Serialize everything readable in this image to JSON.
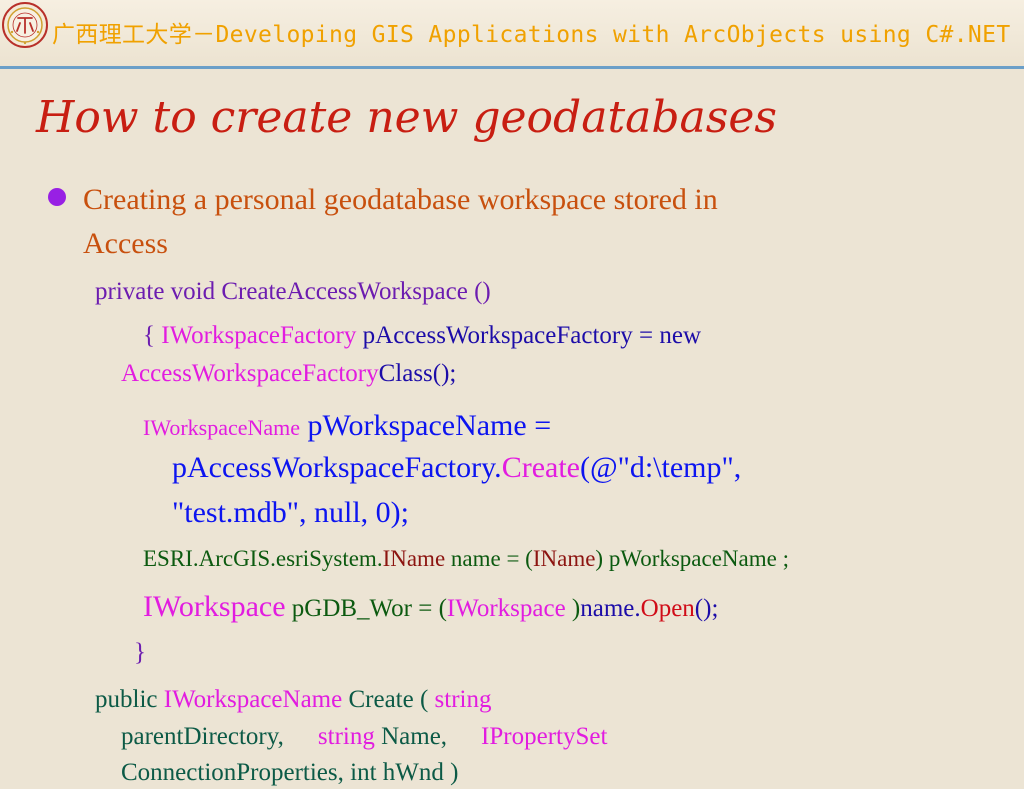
{
  "header": {
    "title_cn": "广西理工大学",
    "title_dash": "－",
    "title_en": "Developing GIS Applications with ArcObjects using C#.NET"
  },
  "slide": {
    "title": "How to create new geodatabases",
    "bullet_line1": "Creating a personal geodatabase workspace stored in",
    "bullet_line2": "Access"
  },
  "code": {
    "l1": "private void CreateAccessWorkspace ()",
    "l2_brace": "{ ",
    "l2_type": "IWorkspaceFactory",
    "l2_rest": " pAccessWorkspaceFactory = new",
    "l3_type": "AccessWorkspaceFactory",
    "l3_rest": "Class();",
    "l4_type": "IWorkspaceName",
    "l4_rest": " pWorkspaceName =",
    "l5_obj": "pAccessWorkspaceFactory.",
    "l5_method": "Create",
    "l5_rest": "(@\"d:\\temp\",",
    "l6": "\"test.mdb\", null, 0);",
    "l7_ns": "ESRI.ArcGIS.esriSystem.",
    "l7_type": "IName",
    "l7_mid": " name = (",
    "l7_cast": "IName",
    "l7_rest": ") pWorkspaceName ;",
    "l8_type": "IWorkspace",
    "l8_mid": " pGDB_Wor = (",
    "l8_cast": "IWorkspace",
    "l8_close": " )",
    "l8_name": "name.",
    "l8_method": "Open",
    "l8_end": "();",
    "l9": "}",
    "l10_kw": "public ",
    "l10_type": "IWorkspaceName",
    "l10_rest": " Create ( ",
    "l10_str": "string",
    "l11_param": "parentDirectory,",
    "l11_str": "string",
    "l11_name": "Name,",
    "l11_type": "IPropertySet",
    "l12": "ConnectionProperties, int hWnd )"
  },
  "colors": {
    "background": "#ece4d4",
    "header_title": "#f0a100",
    "slide_title": "#c81e12",
    "bullet": "#9820e4",
    "bullet_text": "#c8500e",
    "rule": "#6b9fc8"
  },
  "icons": {
    "logo": "university-seal-logo"
  }
}
